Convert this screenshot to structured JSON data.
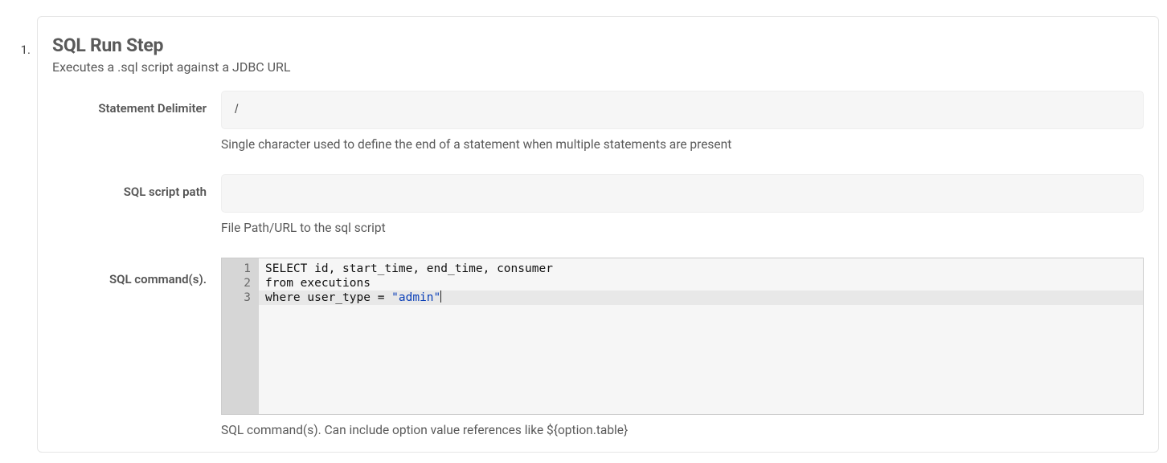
{
  "step_number": "1.",
  "panel": {
    "title": "SQL Run Step",
    "subtitle": "Executes a .sql script against a JDBC URL"
  },
  "fields": {
    "delimiter": {
      "label": "Statement Delimiter",
      "value": "/",
      "help": "Single character used to define the end of a statement when multiple statements are present"
    },
    "script_path": {
      "label": "SQL script path",
      "value": "",
      "help": "File Path/URL to the sql script"
    },
    "sql_commands": {
      "label": "SQL command(s).",
      "help": "SQL command(s). Can include option value references like ${option.table}",
      "gutter": [
        "1",
        "2",
        "3"
      ],
      "line1": "SELECT id, start_time, end_time, consumer",
      "line2": "from executions",
      "line3_a": "where user_type ",
      "line3_op": "=",
      "line3_sp": " ",
      "line3_str": "\"admin\""
    }
  }
}
